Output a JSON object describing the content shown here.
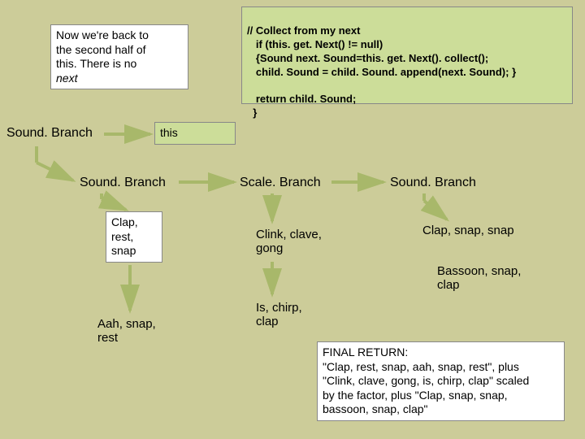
{
  "note": {
    "line1": "Now we're back to",
    "line2": "the second half of",
    "line3": "this. There is no",
    "line4": "next"
  },
  "code": {
    "l1": "// Collect from my next",
    "l2": "   if (this. get. Next() != null)",
    "l3": "   {Sound next. Sound=this. get. Next(). collect();",
    "l4": "   child. Sound = child. Sound. append(next. Sound); }",
    "l5": "",
    "l6": "   return child. Sound;",
    "l7": "  }"
  },
  "tree": {
    "root": "Sound. Branch",
    "this": "this",
    "b1": "Sound. Branch",
    "b1a": "Clap,\nrest,\nsnap",
    "b1b": "Aah, snap,\nrest",
    "b2": "Scale. Branch",
    "b2a": "Clink, clave,\ngong",
    "b2b": "Is, chirp,\nclap",
    "b3": "Sound. Branch",
    "b3a": "Clap, snap, snap",
    "b3b": "Bassoon, snap,\nclap"
  },
  "final": {
    "title": "FINAL RETURN:",
    "l1": "\"Clap, rest, snap, aah, snap, rest\", plus",
    "l2": "\"Clink, clave, gong, is, chirp, clap\" scaled",
    "l3": "by the factor, plus \"Clap, snap, snap,",
    "l4": "bassoon, snap, clap\""
  }
}
